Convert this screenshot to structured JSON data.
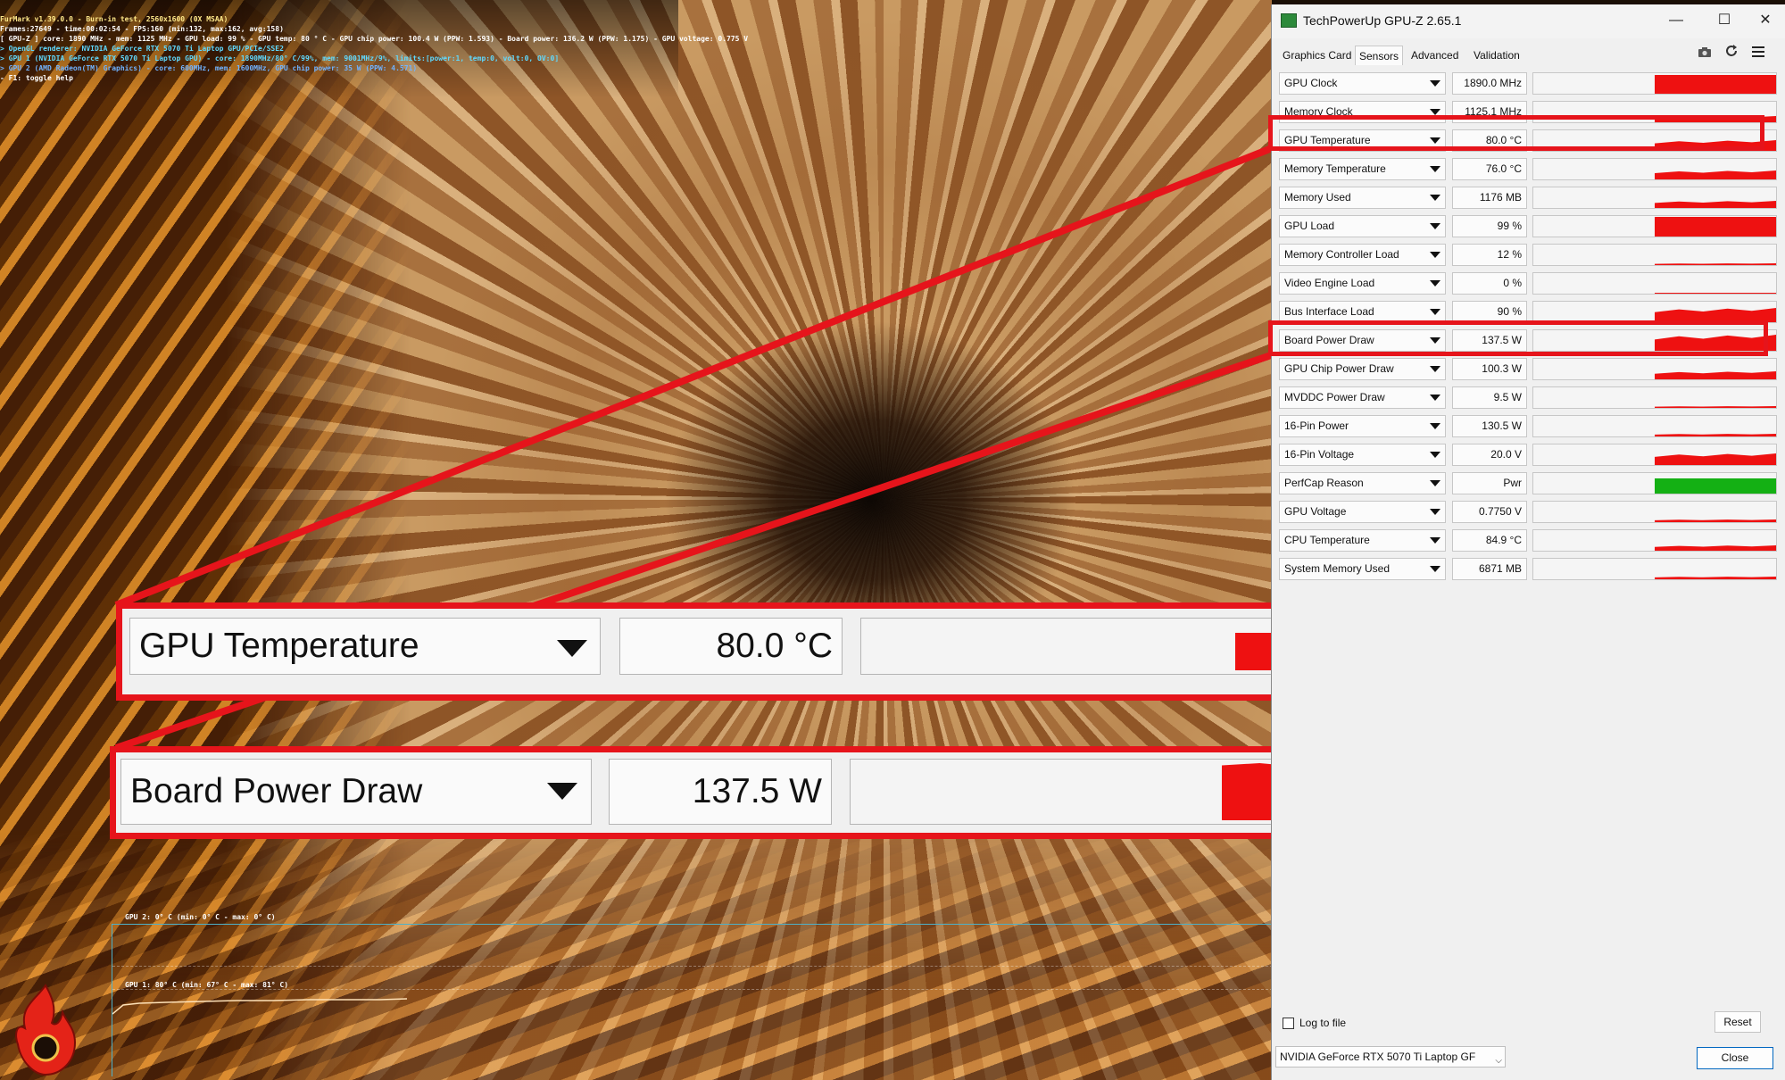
{
  "furmark": {
    "hud_lines": [
      "FurMark v1.39.0.0 - Burn-in test, 2560x1600 (0X MSAA)",
      "Frames:27649 - time:00:02:54 - FPS:160 (min:132, max:162, avg:158)",
      "[ GPU-Z ] core: 1890 MHz - mem: 1125 MHz - GPU load: 99 % - GPU temp: 80 ° C - GPU chip power: 100.4 W (PPW: 1.593) - Board power: 136.2 W (PPW: 1.175) - GPU voltage: 0.775 V",
      "> OpenGL renderer: NVIDIA GeForce RTX 5070 Ti Laptop GPU/PCIe/SSE2",
      "> GPU 1 (NVIDIA GeForce RTX 5070 Ti Laptop GPU) - core: 1890MHz/80° C/99%, mem: 9001MHz/9%, limits:[power:1, temp:0, volt:0, OV:0]",
      "> GPU 2 (AMD Radeon(TM) Graphics) - core: 600MHz, mem: 1600MHz, GPU chip power: 35 W (PPW: 4.571)",
      "- F1: toggle help"
    ],
    "graph_gpu2_label": "GPU 2: 0° C (min: 0° C - max: 0° C)",
    "graph_gpu1_label": "GPU 1: 80° C (min: 67° C - max: 81° C)",
    "logo_text": "FurMark"
  },
  "zoom": {
    "temp_name": "GPU Temperature",
    "temp_value": "80.0 °C",
    "power_name": "Board Power Draw",
    "power_value": "137.5 W"
  },
  "gpuz": {
    "title": "TechPowerUp GPU-Z 2.65.1",
    "window_buttons": {
      "minimize": "—",
      "maximize": "☐",
      "close": "✕"
    },
    "tabs": [
      "Graphics Card",
      "Sensors",
      "Advanced",
      "Validation"
    ],
    "active_tab": "Sensors",
    "sensors": [
      {
        "name": "GPU Clock",
        "value": "1890.0 MHz",
        "level": 0.92
      },
      {
        "name": "Memory Clock",
        "value": "1125.1 MHz",
        "level": 0.3
      },
      {
        "name": "GPU Temperature",
        "value": "80.0 °C",
        "level": 0.5
      },
      {
        "name": "Memory Temperature",
        "value": "76.0 °C",
        "level": 0.45
      },
      {
        "name": "Memory Used",
        "value": "1176 MB",
        "level": 0.35
      },
      {
        "name": "GPU Load",
        "value": "99 %",
        "level": 0.95
      },
      {
        "name": "Memory Controller Load",
        "value": "12 %",
        "level": 0.08
      },
      {
        "name": "Video Engine Load",
        "value": "0 %",
        "level": 0.0
      },
      {
        "name": "Bus Interface Load",
        "value": "90 %",
        "level": 0.7
      },
      {
        "name": "Board Power Draw",
        "value": "137.5 W",
        "level": 0.8
      },
      {
        "name": "GPU Chip Power Draw",
        "value": "100.3 W",
        "level": 0.4
      },
      {
        "name": "MVDDC Power Draw",
        "value": "9.5 W",
        "level": 0.08
      },
      {
        "name": "16-Pin Power",
        "value": "130.5 W",
        "level": 0.15
      },
      {
        "name": "16-Pin Voltage",
        "value": "20.0 V",
        "level": 0.55
      },
      {
        "name": "PerfCap Reason",
        "value": "Pwr",
        "level": 0.75,
        "color": "#14b014"
      },
      {
        "name": "GPU Voltage",
        "value": "0.7750 V",
        "level": 0.15
      },
      {
        "name": "CPU Temperature",
        "value": "84.9 °C",
        "level": 0.25
      },
      {
        "name": "System Memory Used",
        "value": "6871 MB",
        "level": 0.12
      }
    ],
    "log_to_file_label": "Log to file",
    "reset_label": "Reset",
    "gpu_select_value": "NVIDIA GeForce RTX 5070 Ti Laptop GF",
    "close_label": "Close"
  },
  "colors": {
    "highlight": "#e6141b",
    "sensor_bar": "#ee1111",
    "perfcap_bar": "#14b014"
  }
}
